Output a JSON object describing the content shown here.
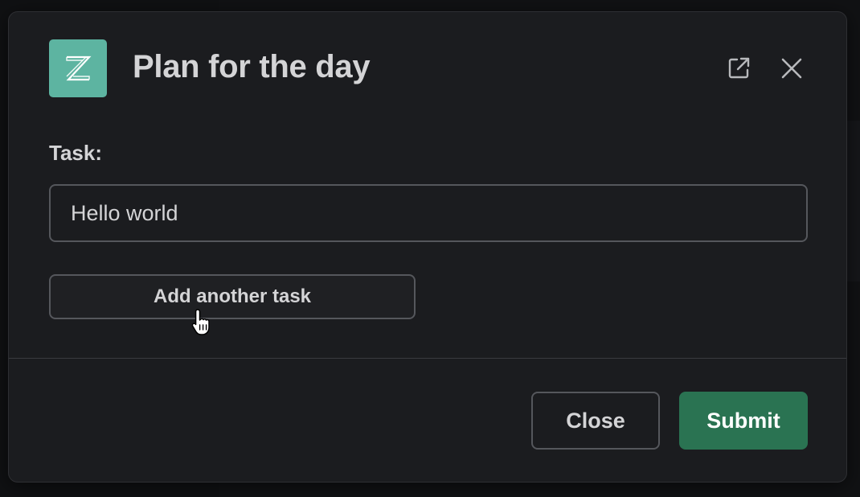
{
  "modal": {
    "title": "Plan for the day",
    "logo_letter": "Z",
    "logo_color": "#5db4a1",
    "icons": {
      "external": "external-link-icon",
      "close": "close-icon"
    }
  },
  "form": {
    "task_label": "Task:",
    "task_value": "Hello world",
    "add_task_label": "Add another task"
  },
  "footer": {
    "close_label": "Close",
    "submit_label": "Submit",
    "submit_color": "#2a7352"
  }
}
